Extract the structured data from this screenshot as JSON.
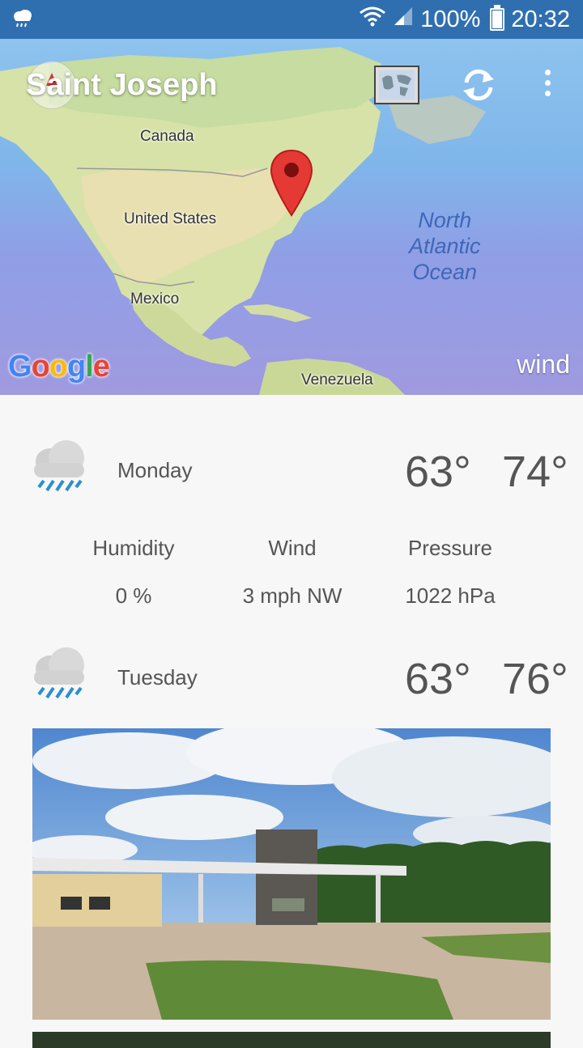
{
  "status_bar": {
    "battery": "100%",
    "time": "20:32",
    "left_icon": "cloud-rain-icon",
    "icons": [
      "wifi-icon",
      "signal-icon",
      "battery-icon"
    ]
  },
  "map": {
    "location_title": "Saint Joseph",
    "labels": {
      "canada": "Canada",
      "united_states": "United States",
      "mexico": "Mexico",
      "venezuela": "Venezuela",
      "ocean_line1": "North",
      "ocean_line2": "Atlantic",
      "ocean_line3": "Ocean"
    },
    "attribution": "Google",
    "layer_label": "wind",
    "buttons": [
      "compass-icon",
      "map-layers-icon",
      "refresh-icon",
      "more-vert-icon"
    ]
  },
  "forecast": [
    {
      "day": "Monday",
      "min": "63°",
      "max": "74°",
      "icon": "rain-cloud-icon"
    },
    {
      "day": "Tuesday",
      "min": "63°",
      "max": "76°",
      "icon": "rain-cloud-icon"
    }
  ],
  "details": {
    "humidity_label": "Humidity",
    "humidity_value": "0 %",
    "wind_label": "Wind",
    "wind_value": "3 mph NW",
    "pressure_label": "Pressure",
    "pressure_value": "1022 hPa"
  },
  "colors": {
    "status_bar": "#2f6fb0",
    "background": "#f7f7f7",
    "pin": "#e53935",
    "rain": "#2a8fd0"
  }
}
